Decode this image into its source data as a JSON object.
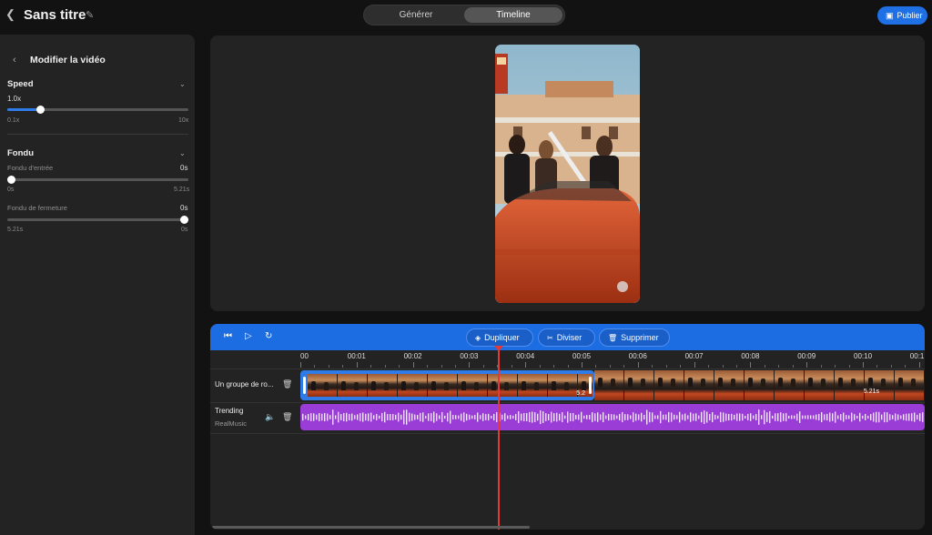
{
  "header": {
    "title": "Sans titre",
    "tabs": [
      {
        "label": "Générer",
        "active": false
      },
      {
        "label": "Timeline",
        "active": true
      }
    ],
    "publish_label": "Publier",
    "accent": "#1f6fe5"
  },
  "sidebar": {
    "title": "Modifier la vidéo",
    "speed": {
      "title": "Speed",
      "value_label": "1.0x",
      "value": 1.0,
      "min_label": "0.1x",
      "max_label": "10x",
      "min": 0.1,
      "max": 10
    },
    "fade": {
      "title": "Fondu",
      "fade_in": {
        "label": "Fondu d'entrée",
        "value_label": "0s",
        "min_label": "0s",
        "max_label": "5.21s",
        "fraction": 0
      },
      "fade_out": {
        "label": "Fondu de fermeture",
        "value_label": "0s",
        "min_label": "5.21s",
        "max_label": "0s",
        "fraction": 1
      }
    }
  },
  "timeline": {
    "toolbar": {
      "duplicate_label": "Dupliquer",
      "split_label": "Diviser",
      "delete_label": "Supprimer"
    },
    "ruler_labels": [
      "00",
      "00:01",
      "00:02",
      "00:03",
      "00:04",
      "00:05",
      "00:06",
      "00:07",
      "00:08",
      "00:09",
      "00:10",
      "00:1"
    ],
    "tracks": {
      "video": {
        "label": "Un groupe de ro...",
        "clip_duration_selected": "5.2",
        "clip_duration_next": "5.21s"
      },
      "audio": {
        "title": "Trending",
        "subtitle": "RealMusic",
        "color": "#9a3cd6"
      }
    },
    "playhead_time_seconds": 3.55
  }
}
